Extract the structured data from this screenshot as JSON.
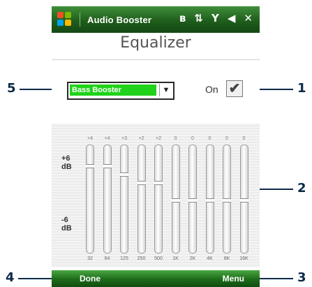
{
  "titlebar": {
    "app_title": "Audio Booster",
    "status_icons": [
      "bluetooth-icon",
      "signal-antenna-icon",
      "signal-strength-icon",
      "speaker-volume-icon",
      "close-icon"
    ],
    "close_label": "✕"
  },
  "heading": "Equalizer",
  "preset": {
    "selected": "Bass Booster"
  },
  "enable": {
    "label": "On",
    "checked": true
  },
  "equalizer": {
    "db_top": "+6\ndB",
    "db_bottom": "-6\ndB",
    "db_top_line1": "+6",
    "db_top_line2": "dB",
    "db_bot_line1": "-6",
    "db_bot_line2": "dB",
    "range_db": [
      -6,
      6
    ],
    "bands": [
      {
        "freq": "32",
        "gain_label": "+4",
        "gain": 4
      },
      {
        "freq": "64",
        "gain_label": "+4",
        "gain": 4
      },
      {
        "freq": "125",
        "gain_label": "+3",
        "gain": 3
      },
      {
        "freq": "250",
        "gain_label": "+2",
        "gain": 2
      },
      {
        "freq": "500",
        "gain_label": "+2",
        "gain": 2
      },
      {
        "freq": "1K",
        "gain_label": "0",
        "gain": 0
      },
      {
        "freq": "2K",
        "gain_label": "0",
        "gain": 0
      },
      {
        "freq": "4K",
        "gain_label": "0",
        "gain": 0
      },
      {
        "freq": "8K",
        "gain_label": "0",
        "gain": 0
      },
      {
        "freq": "16K",
        "gain_label": "0",
        "gain": 0
      }
    ]
  },
  "softkeys": {
    "left": "Done",
    "right": "Menu"
  },
  "callouts": [
    "1",
    "2",
    "3",
    "4",
    "5"
  ],
  "colors": {
    "titlebar": "#1f5e1c",
    "preset_highlight": "#20d21a",
    "callout": "#0b2a4a"
  }
}
